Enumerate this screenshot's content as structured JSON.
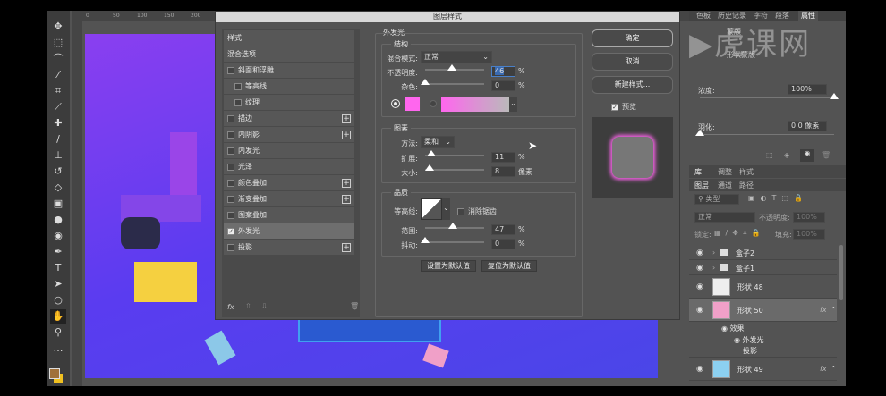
{
  "toolbar": {
    "tools": [
      "move",
      "marquee",
      "lasso",
      "magic-wand",
      "crop",
      "eyedropper",
      "healing",
      "brush",
      "stamp",
      "history-brush",
      "eraser",
      "gradient",
      "blur",
      "dodge",
      "pen",
      "type",
      "path-select",
      "ellipse",
      "hand",
      "zoom",
      "more"
    ],
    "fg_color": "#a0703a",
    "bg_color": "#f0c020"
  },
  "ruler": {
    "top": [
      "0",
      "50",
      "100",
      "150",
      "200"
    ]
  },
  "dialog": {
    "title": "图层样式",
    "list": {
      "header": "样式",
      "blend": "混合选项",
      "items": [
        {
          "label": "斜面和浮雕",
          "checked": false,
          "plus": false,
          "indent": false
        },
        {
          "label": "等高线",
          "checked": false,
          "plus": false,
          "indent": true
        },
        {
          "label": "纹理",
          "checked": false,
          "plus": false,
          "indent": true
        },
        {
          "label": "描边",
          "checked": false,
          "plus": true,
          "indent": false
        },
        {
          "label": "内阴影",
          "checked": false,
          "plus": true,
          "indent": false
        },
        {
          "label": "内发光",
          "checked": false,
          "plus": false,
          "indent": false
        },
        {
          "label": "光泽",
          "checked": false,
          "plus": false,
          "indent": false
        },
        {
          "label": "颜色叠加",
          "checked": false,
          "plus": true,
          "indent": false
        },
        {
          "label": "渐变叠加",
          "checked": false,
          "plus": true,
          "indent": false
        },
        {
          "label": "图案叠加",
          "checked": false,
          "plus": false,
          "indent": false
        },
        {
          "label": "外发光",
          "checked": true,
          "plus": false,
          "indent": false
        },
        {
          "label": "投影",
          "checked": false,
          "plus": true,
          "indent": false
        }
      ],
      "fx": "fx"
    },
    "outer_glow": {
      "title": "外发光",
      "structure": {
        "title": "结构",
        "blend_label": "混合模式:",
        "blend_value": "正常",
        "opacity_label": "不透明度:",
        "opacity": "46",
        "opacity_pct": 0.46,
        "noise_label": "杂色:",
        "noise": "0",
        "noise_pct": 0,
        "unit": "%",
        "glow_color": "#ff66ee"
      },
      "elements": {
        "title": "图素",
        "method_label": "方法:",
        "method_value": "柔和",
        "spread_label": "扩展:",
        "spread": "11",
        "spread_unit": "%",
        "size_label": "大小:",
        "size": "8",
        "size_unit": "像素"
      },
      "quality": {
        "title": "品质",
        "contour_label": "等高线:",
        "antialias": "消除锯齿",
        "range_label": "范围:",
        "range": "47",
        "jitter_label": "抖动:",
        "jitter": "0",
        "unit": "%"
      },
      "set_default": "设置为默认值",
      "reset_default": "复位为默认值"
    },
    "buttons": {
      "ok": "确定",
      "cancel": "取消",
      "new_style": "新建样式...",
      "preview": "预览"
    }
  },
  "panels": {
    "top_tabs": [
      "色板",
      "历史记录",
      "字符",
      "段落",
      "属性"
    ],
    "properties": {
      "mask_label": "蒙版",
      "shape_mask": "形状蒙版",
      "density_label": "浓度:",
      "density": "100%",
      "feather_label": "羽化:",
      "feather": "0.0 像素"
    },
    "tabs2": [
      "库",
      "调整",
      "样式"
    ],
    "tabs3": [
      "图层",
      "通道",
      "路径"
    ],
    "filter": "类型",
    "blend_mode": "正常",
    "opacity_label": "不透明度:",
    "opacity": "100%",
    "lock_label": "锁定:",
    "fill_label": "填充:",
    "fill": "100%",
    "layers": [
      {
        "name": "盒子2",
        "type": "group"
      },
      {
        "name": "盒子1",
        "type": "group"
      },
      {
        "name": "形状 48",
        "type": "shape"
      },
      {
        "name": "形状 50",
        "type": "shape",
        "selected": true,
        "fx": "fx",
        "effects_label": "效果",
        "effects": [
          "外发光",
          "投影"
        ]
      },
      {
        "name": "形状 49",
        "type": "shape",
        "fx": "fx"
      }
    ]
  },
  "watermark": "虎课网"
}
